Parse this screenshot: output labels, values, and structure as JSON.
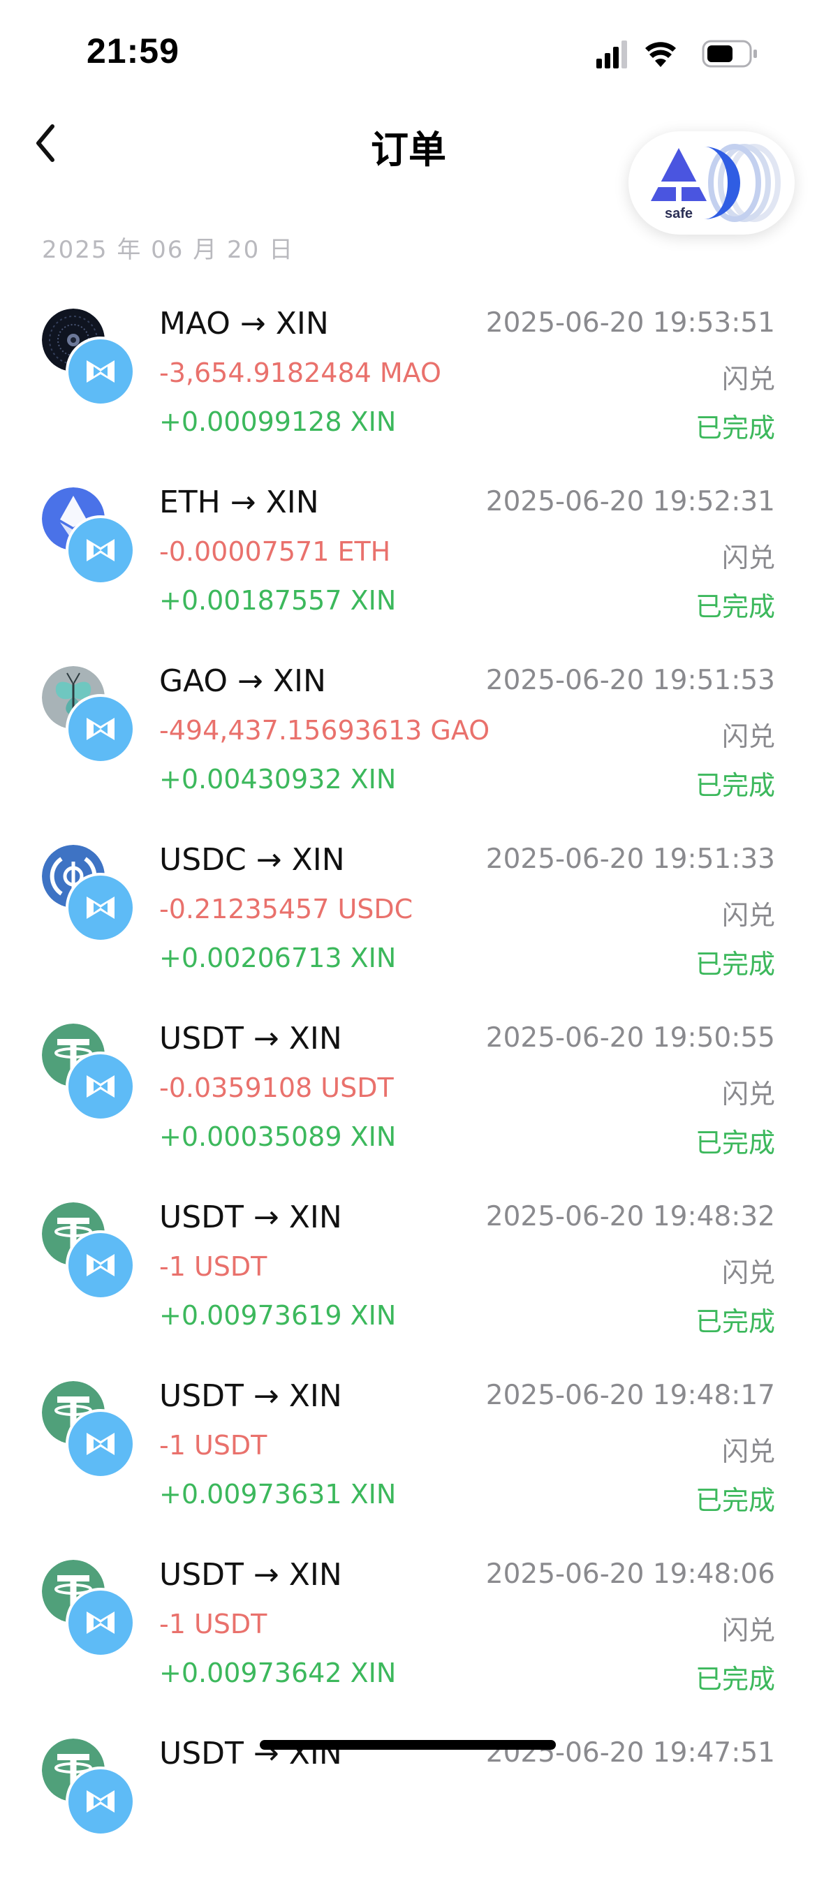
{
  "status_bar": {
    "time": "21:59"
  },
  "header": {
    "title": "订单",
    "badge_text": "safe"
  },
  "date_label": "2025 年 06 月 20 日",
  "colors": {
    "negative": "#e9716c",
    "positive": "#3cb85c",
    "secondary": "#8a8a8e",
    "xin_blue": "#5ebbf6"
  },
  "orders": [
    {
      "pair": "MAO → XIN",
      "pay": "-3,654.9182484 MAO",
      "receive": "+0.00099128 XIN",
      "time": "2025-06-20 19:53:51",
      "type": "闪兑",
      "status": "已完成",
      "source_icon": "mao-coin-icon"
    },
    {
      "pair": "ETH → XIN",
      "pay": "-0.00007571 ETH",
      "receive": "+0.00187557 XIN",
      "time": "2025-06-20 19:52:31",
      "type": "闪兑",
      "status": "已完成",
      "source_icon": "eth-coin-icon"
    },
    {
      "pair": "GAO → XIN",
      "pay": "-494,437.15693613 GAO",
      "receive": "+0.00430932 XIN",
      "time": "2025-06-20 19:51:53",
      "type": "闪兑",
      "status": "已完成",
      "source_icon": "gao-coin-icon"
    },
    {
      "pair": "USDC → XIN",
      "pay": "-0.21235457 USDC",
      "receive": "+0.00206713 XIN",
      "time": "2025-06-20 19:51:33",
      "type": "闪兑",
      "status": "已完成",
      "source_icon": "usdc-coin-icon"
    },
    {
      "pair": "USDT → XIN",
      "pay": "-0.0359108 USDT",
      "receive": "+0.00035089 XIN",
      "time": "2025-06-20 19:50:55",
      "type": "闪兑",
      "status": "已完成",
      "source_icon": "usdt-coin-icon"
    },
    {
      "pair": "USDT → XIN",
      "pay": "-1 USDT",
      "receive": "+0.00973619 XIN",
      "time": "2025-06-20 19:48:32",
      "type": "闪兑",
      "status": "已完成",
      "source_icon": "usdt-coin-icon"
    },
    {
      "pair": "USDT → XIN",
      "pay": "-1 USDT",
      "receive": "+0.00973631 XIN",
      "time": "2025-06-20 19:48:17",
      "type": "闪兑",
      "status": "已完成",
      "source_icon": "usdt-coin-icon"
    },
    {
      "pair": "USDT → XIN",
      "pay": "-1 USDT",
      "receive": "+0.00973642 XIN",
      "time": "2025-06-20 19:48:06",
      "type": "闪兑",
      "status": "已完成",
      "source_icon": "usdt-coin-icon"
    },
    {
      "pair": "USDT → XIN",
      "pay": "",
      "receive": "",
      "time": "2025-06-20 19:47:51",
      "type": "",
      "status": "",
      "source_icon": "usdt-coin-icon"
    }
  ]
}
